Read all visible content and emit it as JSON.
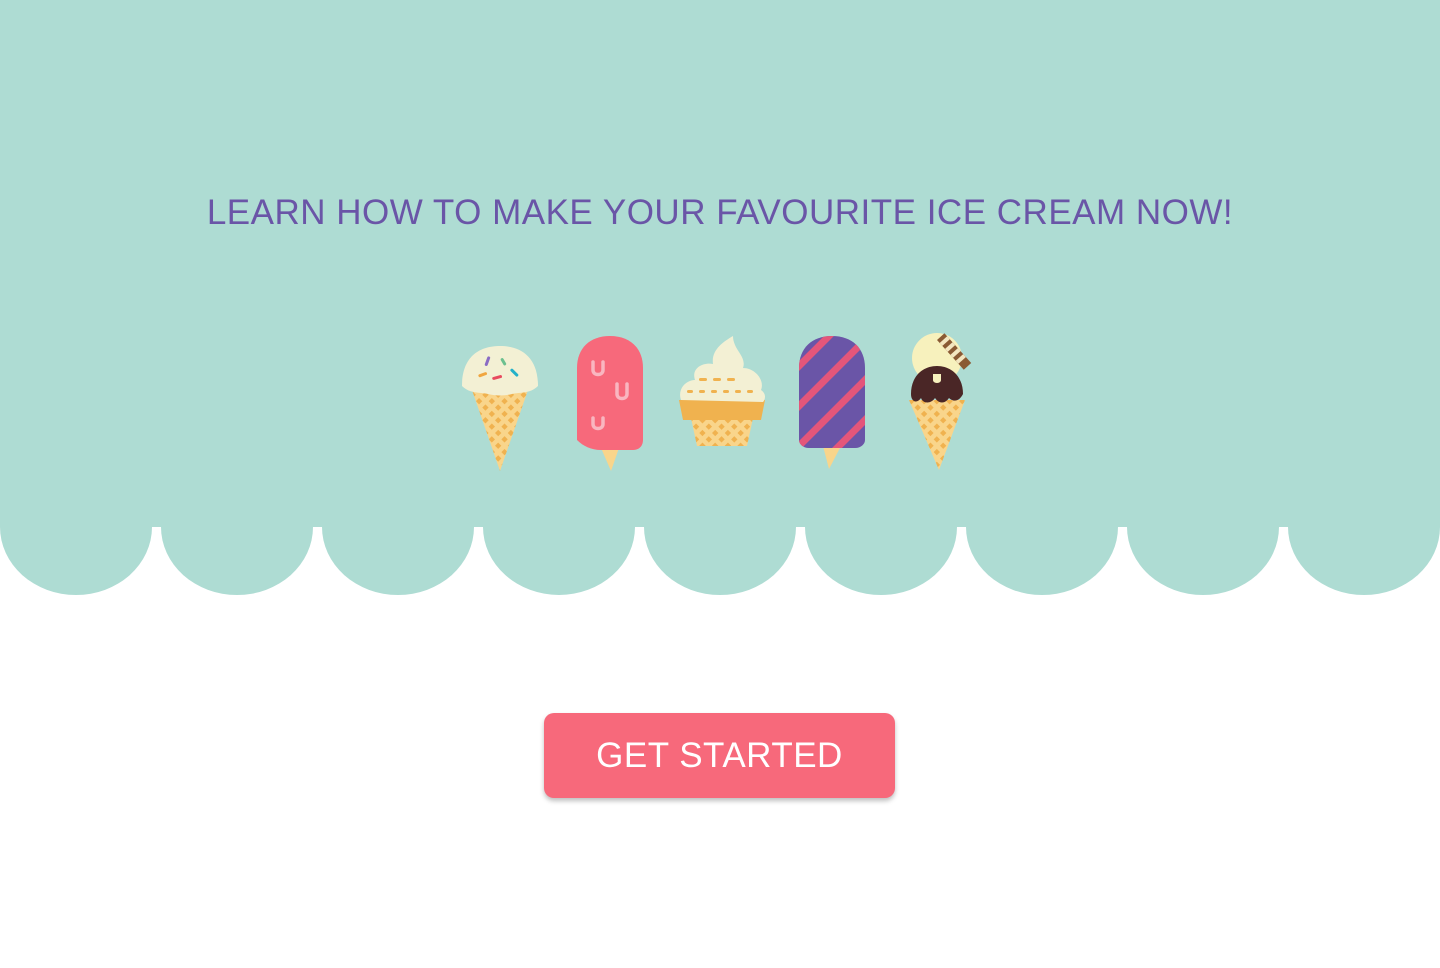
{
  "hero": {
    "headline": "LEARN HOW TO MAKE YOUR FAVOURITE ICE CREAM NOW!",
    "background_color": "#aedcd3",
    "headline_color": "#6a55a7",
    "illustrations": [
      "sprinkle-cone-icon",
      "pink-popsicle-icon",
      "cupcake-cone-icon",
      "striped-popsicle-icon",
      "chocolate-cone-icon"
    ]
  },
  "cta": {
    "label": "GET STARTED",
    "color": "#f7697b"
  }
}
